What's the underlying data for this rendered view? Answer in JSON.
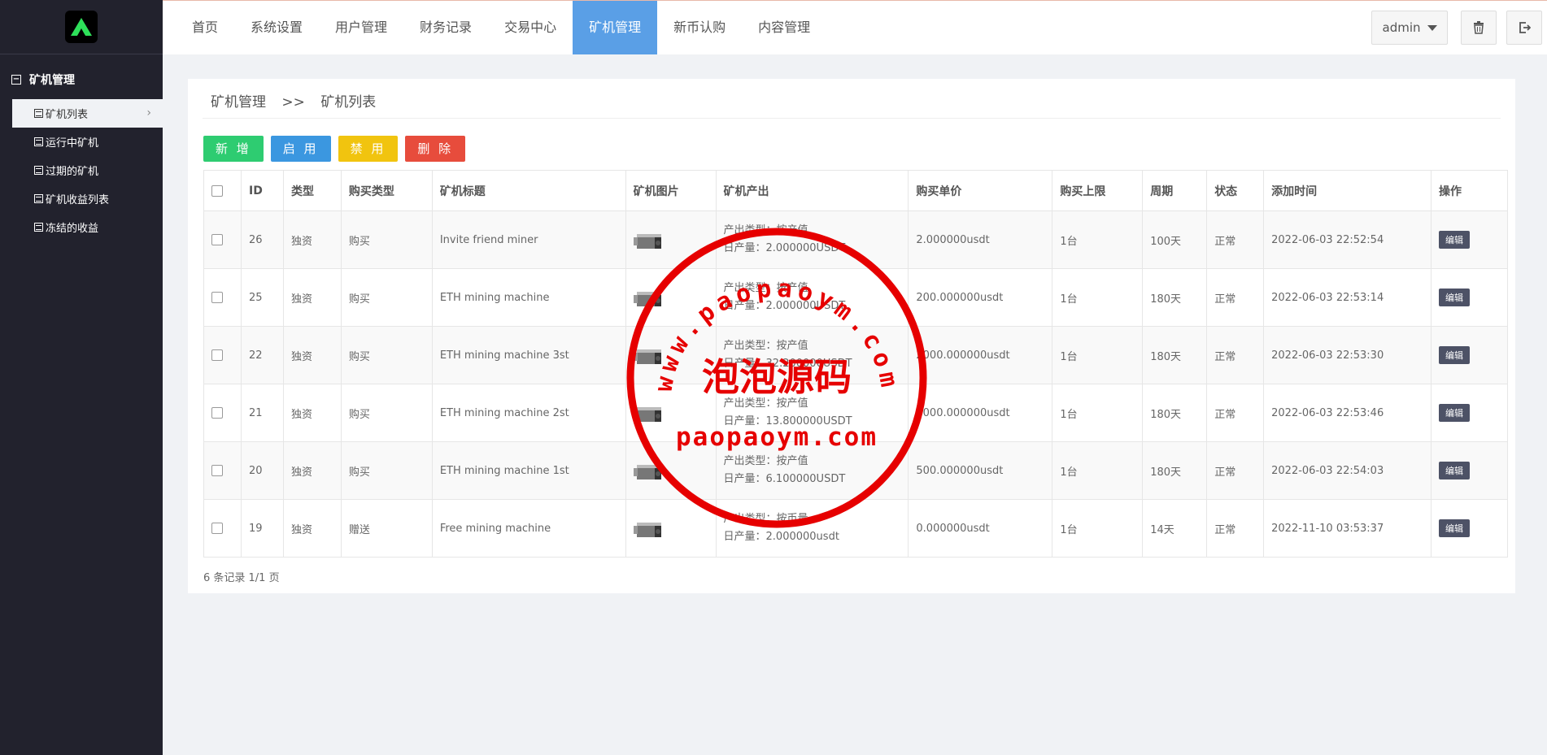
{
  "sidebar": {
    "group_label": "矿机管理",
    "items": [
      {
        "label": "矿机列表"
      },
      {
        "label": "运行中矿机"
      },
      {
        "label": "过期的矿机"
      },
      {
        "label": "矿机收益列表"
      },
      {
        "label": "冻结的收益"
      }
    ]
  },
  "topnav": {
    "items": [
      {
        "label": "首页"
      },
      {
        "label": "系统设置"
      },
      {
        "label": "用户管理"
      },
      {
        "label": "财务记录"
      },
      {
        "label": "交易中心"
      },
      {
        "label": "矿机管理"
      },
      {
        "label": "新币认购"
      },
      {
        "label": "内容管理"
      }
    ],
    "active_index": 5,
    "user": "admin"
  },
  "breadcrumb": {
    "section": "矿机管理",
    "sep": ">>",
    "page": "矿机列表"
  },
  "buttons": {
    "add": "新 增",
    "enable": "启 用",
    "disable": "禁 用",
    "delete": "删 除"
  },
  "table": {
    "headers": [
      "ID",
      "类型",
      "购买类型",
      "矿机标题",
      "矿机图片",
      "矿机产出",
      "购买单价",
      "购买上限",
      "周期",
      "状态",
      "添加时间",
      "操作"
    ],
    "rows": [
      {
        "id": "26",
        "type": "独资",
        "buy_type": "购买",
        "title": "Invite friend miner",
        "output_type": "产出类型：按产值",
        "daily": "日产量：2.000000USDT",
        "price": "2.000000usdt",
        "limit": "1台",
        "period": "100天",
        "status": "正常",
        "time": "2022-06-03 22:52:54",
        "action": "编辑"
      },
      {
        "id": "25",
        "type": "独资",
        "buy_type": "购买",
        "title": "ETH mining machine",
        "output_type": "产出类型：按产值",
        "daily": "日产量：2.000000USDT",
        "price": "200.000000usdt",
        "limit": "1台",
        "period": "180天",
        "status": "正常",
        "time": "2022-06-03 22:53:14",
        "action": "编辑"
      },
      {
        "id": "22",
        "type": "独资",
        "buy_type": "购买",
        "title": "ETH mining machine 3st",
        "output_type": "产出类型：按产值",
        "daily": "日产量：32.200000USDT",
        "price": "2000.000000usdt",
        "limit": "1台",
        "period": "180天",
        "status": "正常",
        "time": "2022-06-03 22:53:30",
        "action": "编辑"
      },
      {
        "id": "21",
        "type": "独资",
        "buy_type": "购买",
        "title": "ETH mining machine 2st",
        "output_type": "产出类型：按产值",
        "daily": "日产量：13.800000USDT",
        "price": "1000.000000usdt",
        "limit": "1台",
        "period": "180天",
        "status": "正常",
        "time": "2022-06-03 22:53:46",
        "action": "编辑"
      },
      {
        "id": "20",
        "type": "独资",
        "buy_type": "购买",
        "title": "ETH mining machine 1st",
        "output_type": "产出类型：按产值",
        "daily": "日产量：6.100000USDT",
        "price": "500.000000usdt",
        "limit": "1台",
        "period": "180天",
        "status": "正常",
        "time": "2022-06-03 22:54:03",
        "action": "编辑"
      },
      {
        "id": "19",
        "type": "独资",
        "buy_type": "赠送",
        "title": "Free mining machine",
        "output_type": "产出类型：按币量",
        "daily": "日产量：2.000000usdt",
        "price": "0.000000usdt",
        "limit": "1台",
        "period": "14天",
        "status": "正常",
        "time": "2022-11-10 03:53:37",
        "action": "编辑"
      }
    ]
  },
  "pagination": "6 条记录 1/1 页",
  "watermark": {
    "arc_text": "www.paopaoym.com",
    "center_text": "泡泡源码",
    "bottom_text": "paopaoym.com"
  },
  "colors": {
    "sidebar": "#22222d",
    "nav_active": "#5a9fe6",
    "add": "#2ecc71",
    "enable": "#3b97e0",
    "disable": "#f1c40f",
    "delete": "#e74c3c",
    "stamp": "#e60000"
  }
}
